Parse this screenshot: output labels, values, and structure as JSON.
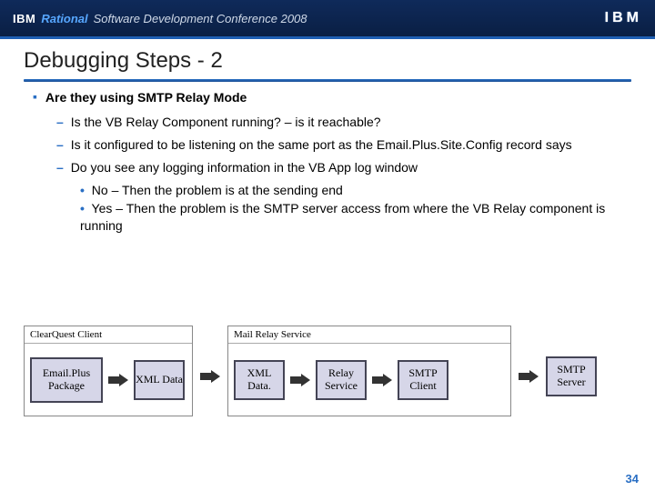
{
  "header": {
    "brand_ibm": "IBM",
    "brand_rational": "Rational",
    "brand_rest": "Software Development Conference 2008",
    "logo_text": "IBM"
  },
  "title": "Debugging Steps - 2",
  "content": {
    "b1": "Are they using SMTP Relay Mode",
    "b1_1": "Is the VB Relay Component running? – is it reachable?",
    "b1_2": "Is it configured to be listening on the same port as the Email.Plus.Site.Config record says",
    "b1_3": "Do you see any logging information in the VB App log window",
    "b1_3_a": "No – Then the problem is at the sending end",
    "b1_3_b": "Yes – Then the problem is the SMTP server access from where the VB Relay component is running"
  },
  "diagram": {
    "group1_title": "ClearQuest Client",
    "group2_title": "Mail Relay Service",
    "box_emailplus": "Email.Plus Package",
    "box_xml1": "XML Data",
    "box_xml2": "XML Data.",
    "box_relay": "Relay Service",
    "box_smtpclient": "SMTP Client",
    "box_smtpserver": "SMTP Server"
  },
  "page_number": "34"
}
